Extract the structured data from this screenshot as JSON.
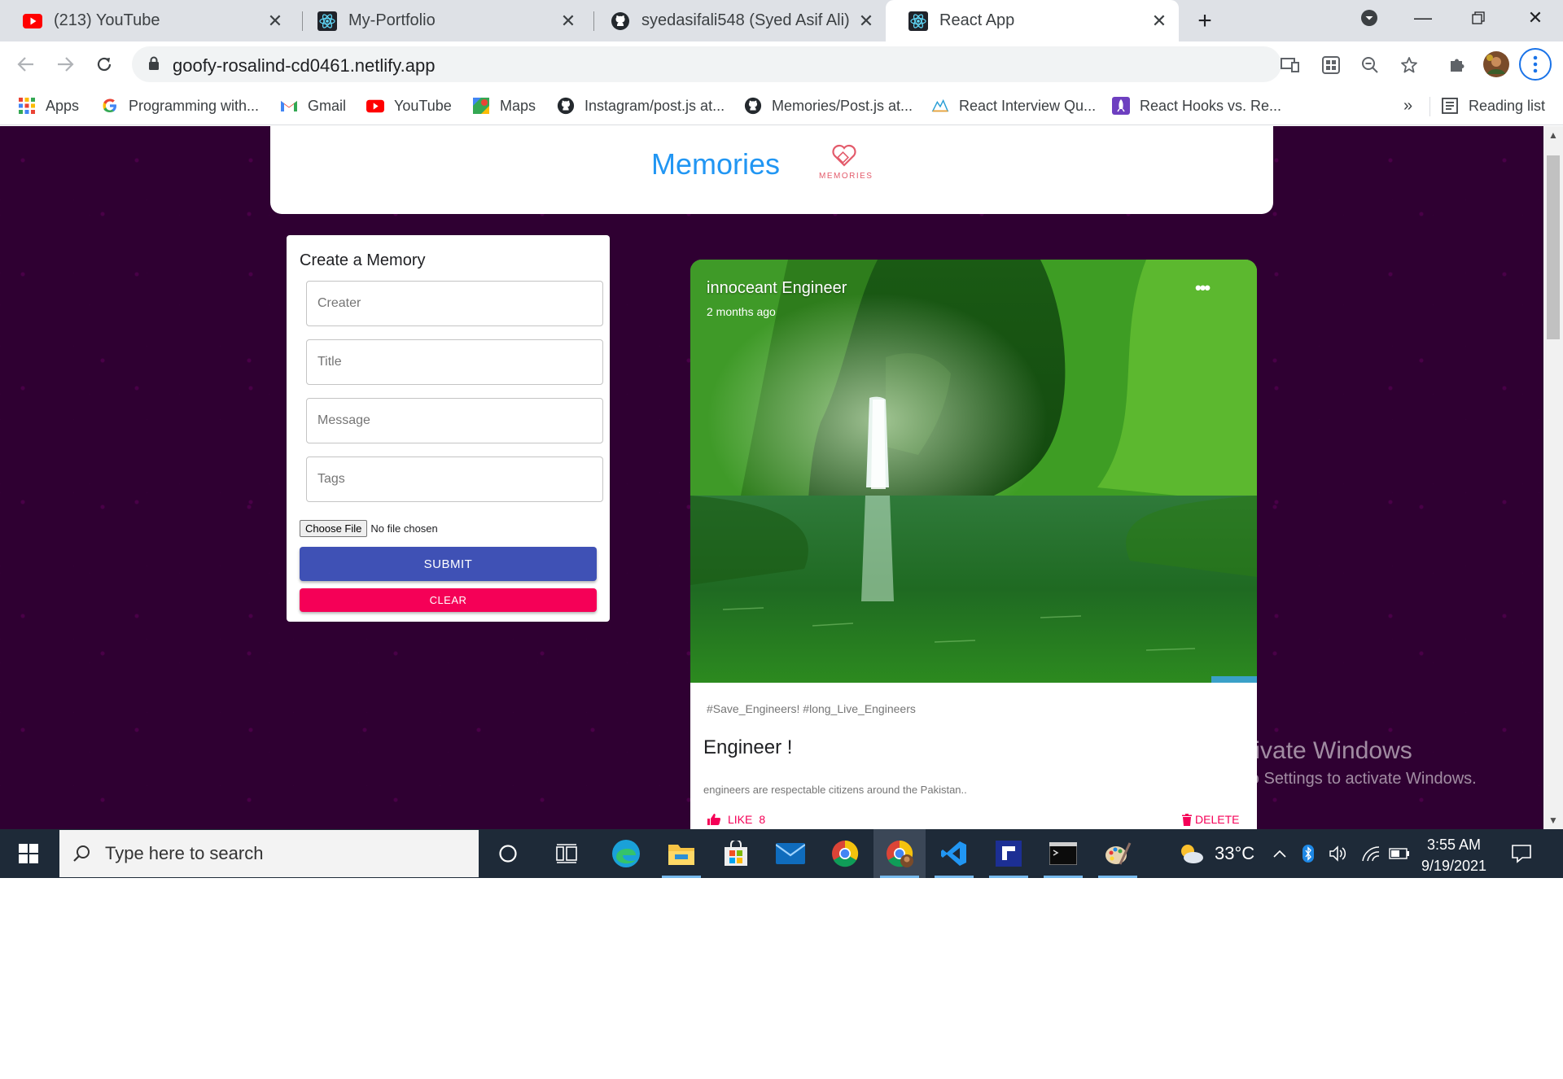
{
  "browser": {
    "tabs": [
      {
        "title": "(213) YouTube",
        "icon": "youtube-icon",
        "active": false
      },
      {
        "title": "My-Portfolio",
        "icon": "react-icon",
        "active": false
      },
      {
        "title": "syedasifali548 (Syed Asif Ali)",
        "icon": "github-icon",
        "active": false
      },
      {
        "title": "React App",
        "icon": "react-icon",
        "active": true
      }
    ],
    "url": "goofy-rosalind-cd0461.netlify.app",
    "bookmarks": [
      {
        "label": "Apps",
        "icon": "apps-grid-icon"
      },
      {
        "label": "Programming with...",
        "icon": "google-icon"
      },
      {
        "label": "Gmail",
        "icon": "gmail-icon"
      },
      {
        "label": "YouTube",
        "icon": "youtube-icon"
      },
      {
        "label": "Maps",
        "icon": "maps-icon"
      },
      {
        "label": "Instagram/post.js at...",
        "icon": "github-icon"
      },
      {
        "label": "Memories/Post.js at...",
        "icon": "github-icon"
      },
      {
        "label": "React Interview Qu...",
        "icon": "site-icon"
      },
      {
        "label": "React Hooks vs. Re...",
        "icon": "rocket-icon"
      }
    ],
    "bookmarks_overflow": "»",
    "reading_list": "Reading list"
  },
  "app": {
    "heading": "Memories",
    "logo_text": "MEMORIES",
    "form": {
      "title": "Create a Memory",
      "creator_placeholder": "Creater",
      "title_placeholder": "Title",
      "message_placeholder": "Message",
      "tags_placeholder": "Tags",
      "file_button": "Choose File",
      "file_status": "No file chosen",
      "submit_label": "SUBMIT",
      "clear_label": "CLEAR"
    },
    "post": {
      "creator": "innoceant Engineer",
      "time": "2 months ago",
      "tags": "#Save_Engineers! #long_Live_Engineers",
      "title": "Engineer !",
      "message": "engineers are respectable citizens around the Pakistan..",
      "like_label": "LIKE",
      "like_count": "8",
      "delete_label": "DELETE"
    },
    "colors": {
      "background": "#2f0032",
      "primary": "#3f51b5",
      "secondary": "#f50057",
      "heading": "#2196f3"
    }
  },
  "watermark": {
    "line1": "Activate Windows",
    "line2": "Go to Settings to activate Windows."
  },
  "taskbar": {
    "search_placeholder": "Type here to search",
    "weather": "33°C",
    "time": "3:55 AM",
    "date": "9/19/2021"
  }
}
